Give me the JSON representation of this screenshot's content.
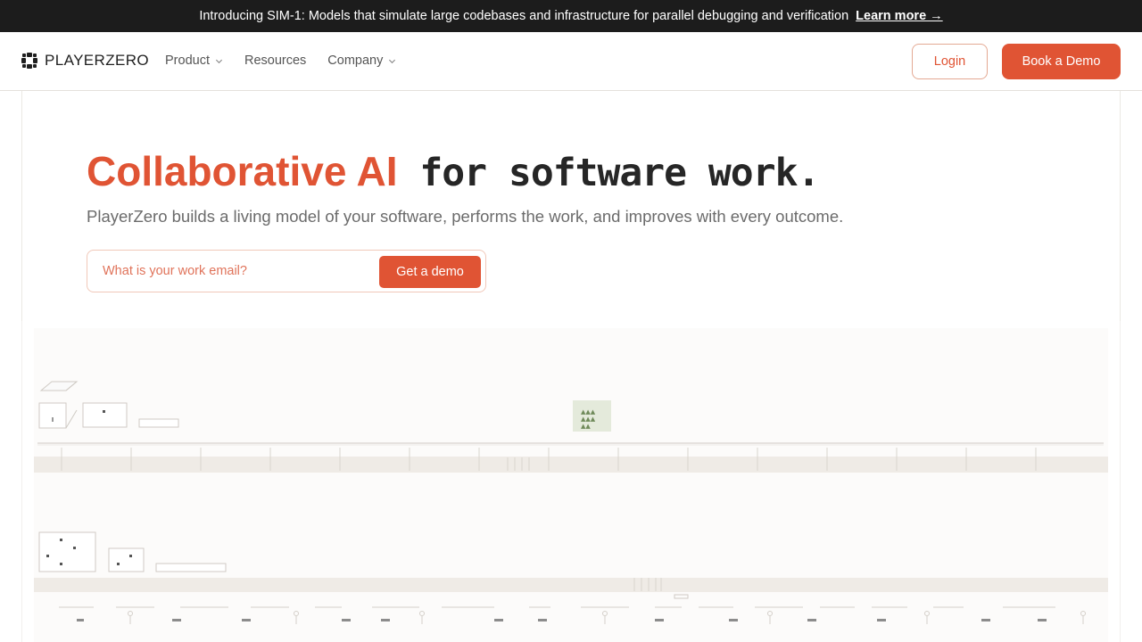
{
  "announcement": {
    "message": "Introducing SIM-1: Models that simulate large codebases and infrastructure for parallel debugging and verification",
    "link": "Learn more →"
  },
  "nav": {
    "logo_text": "PLAYERZERO",
    "menu": [
      {
        "label": "Product",
        "dropdown": true
      },
      {
        "label": "Resources",
        "dropdown": false
      },
      {
        "label": "Company",
        "dropdown": true
      }
    ],
    "login_label": "Login",
    "demo_label": "Book a Demo"
  },
  "hero": {
    "headline_accent": "Collaborative AI",
    "headline_rest": " for software work.",
    "subheadline": "PlayerZero builds a living model of your software, performs the work, and improves with every outcome.",
    "email_placeholder": "What is your work email?",
    "cta_label": "Get a demo"
  },
  "colors": {
    "accent": "#e05434",
    "dark": "#1c1c1c",
    "band": "#efebe6"
  },
  "icons": {
    "logo": "playerzero-logo-icon",
    "dropdown": "chevron-down-icon"
  }
}
